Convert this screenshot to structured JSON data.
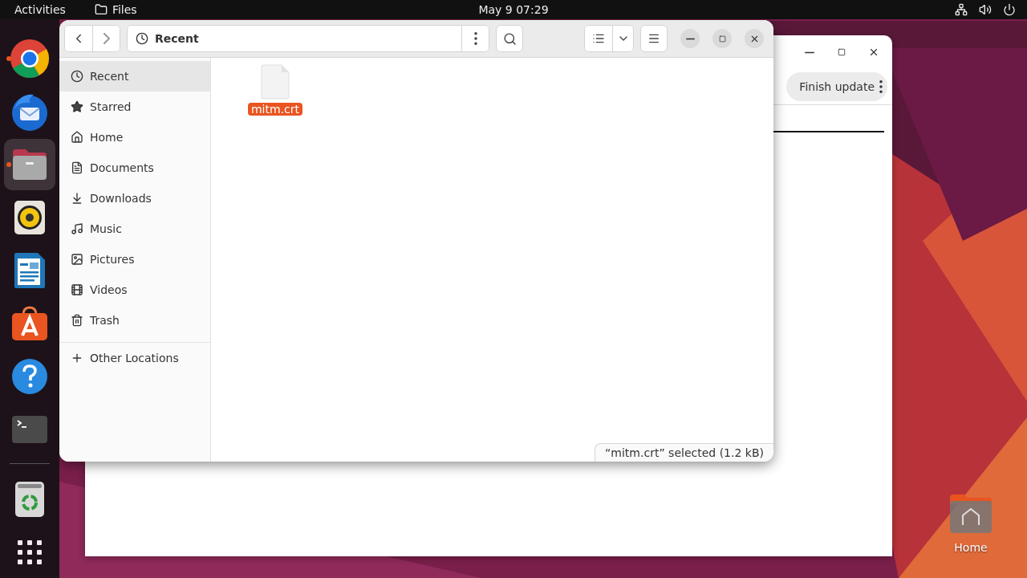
{
  "top_bar": {
    "activities": "Activities",
    "app": "Files",
    "clock": "May 9  07:29"
  },
  "dock": {
    "apps": [
      {
        "kind": "chrome",
        "running": true,
        "selected": false
      },
      {
        "kind": "mail",
        "running": false,
        "selected": false
      },
      {
        "kind": "files",
        "running": true,
        "selected": true
      },
      {
        "kind": "music",
        "running": false,
        "selected": false
      },
      {
        "kind": "writer",
        "running": false,
        "selected": false
      },
      {
        "kind": "store",
        "running": false,
        "selected": false
      },
      {
        "kind": "help",
        "running": false,
        "selected": false
      },
      {
        "kind": "terminal",
        "running": false,
        "selected": false
      }
    ],
    "pinned": [
      {
        "kind": "trash"
      },
      {
        "kind": "grid"
      }
    ]
  },
  "back_window": {
    "button": "Finish update"
  },
  "files_window": {
    "location": "Recent",
    "sidebar": {
      "items": [
        {
          "kind": "recent",
          "label": "Recent",
          "selected": true
        },
        {
          "kind": "starred",
          "label": "Starred",
          "selected": false
        },
        {
          "kind": "home",
          "label": "Home",
          "selected": false
        },
        {
          "kind": "documents",
          "label": "Documents",
          "selected": false
        },
        {
          "kind": "downloads",
          "label": "Downloads",
          "selected": false
        },
        {
          "kind": "music",
          "label": "Music",
          "selected": false
        },
        {
          "kind": "pictures",
          "label": "Pictures",
          "selected": false
        },
        {
          "kind": "videos",
          "label": "Videos",
          "selected": false
        },
        {
          "kind": "trash",
          "label": "Trash",
          "selected": false
        }
      ],
      "other": "Other Locations"
    },
    "files": [
      {
        "name": "mitm.crt",
        "selected": true
      }
    ],
    "status": "“mitm.crt” selected  (1.2 kB)"
  },
  "desktop_icons": [
    {
      "label": "Home"
    }
  ]
}
